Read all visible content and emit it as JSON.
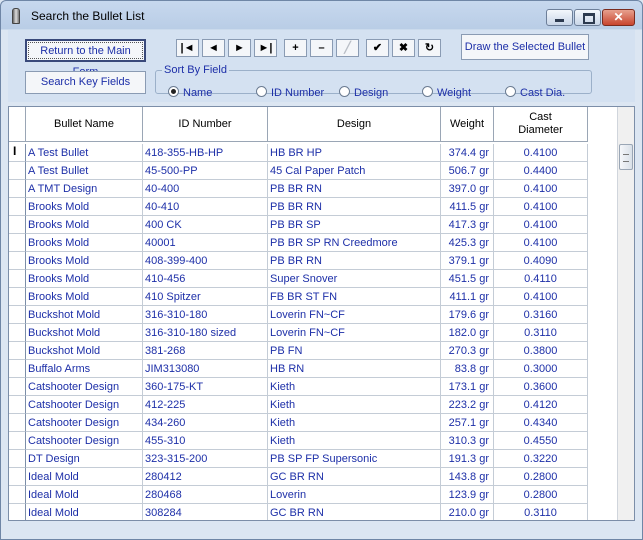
{
  "window": {
    "title": "Search the Bullet List"
  },
  "toolbar": {
    "main_form_label": "Return to the Main Form",
    "search_key_label": "Search Key Fields",
    "draw_label": "Draw the Selected Bullet",
    "sort_legend": "Sort By Field",
    "sort_options": [
      "Name",
      "ID Number",
      "Design",
      "Weight",
      "Cast Dia."
    ],
    "sort_selected": "Name"
  },
  "nav_buttons": [
    {
      "icon": "first-record-icon",
      "glyph": "|◄"
    },
    {
      "icon": "prev-record-icon",
      "glyph": "◄"
    },
    {
      "icon": "next-record-icon",
      "glyph": "►"
    },
    {
      "icon": "last-record-icon",
      "glyph": "►|"
    },
    {
      "icon": "add-record-icon",
      "glyph": "+"
    },
    {
      "icon": "delete-record-icon",
      "glyph": "–"
    },
    {
      "icon": "edit-record-icon",
      "glyph": "╱"
    },
    {
      "icon": "post-record-icon",
      "glyph": "✔"
    },
    {
      "icon": "cancel-record-icon",
      "glyph": "✖"
    },
    {
      "icon": "refresh-icon",
      "glyph": "↻"
    }
  ],
  "table": {
    "columns": [
      "Bullet Name",
      "ID Number",
      "Design",
      "Weight",
      "Cast\nDiameter"
    ],
    "rows": [
      [
        "A Test Bullet",
        "418-355-HB-HP",
        "HB BR HP",
        "374.4 gr",
        "0.4100"
      ],
      [
        "A Test Bullet",
        "45-500-PP",
        "45 Cal Paper Patch",
        "506.7 gr",
        "0.4400"
      ],
      [
        "A TMT Design",
        "40-400",
        "PB BR RN",
        "397.0 gr",
        "0.4100"
      ],
      [
        "Brooks Mold",
        "40-410",
        "PB BR RN",
        "411.5 gr",
        "0.4100"
      ],
      [
        "Brooks Mold",
        "400 CK",
        "PB BR SP",
        "417.3 gr",
        "0.4100"
      ],
      [
        "Brooks Mold",
        "40001",
        "PB BR SP RN Creedmore",
        "425.3 gr",
        "0.4100"
      ],
      [
        "Brooks Mold",
        "408-399-400",
        "PB BR RN",
        "379.1 gr",
        "0.4090"
      ],
      [
        "Brooks Mold",
        "410-456",
        "Super Snover",
        "451.5 gr",
        "0.4110"
      ],
      [
        "Brooks Mold",
        "410 Spitzer",
        "FB BR ST FN",
        "411.1 gr",
        "0.4100"
      ],
      [
        "Buckshot Mold",
        "316-310-180",
        "Loverin FN~CF",
        "179.6 gr",
        "0.3160"
      ],
      [
        "Buckshot Mold",
        "316-310-180 sized",
        "Loverin FN~CF",
        "182.0 gr",
        "0.3110"
      ],
      [
        "Buckshot Mold",
        "381-268",
        "PB FN",
        "270.3 gr",
        "0.3800"
      ],
      [
        "Buffalo Arms",
        "JIM313080",
        "HB RN",
        "83.8 gr",
        "0.3000"
      ],
      [
        "Catshooter Design",
        "360-175-KT",
        "Kieth",
        "173.1 gr",
        "0.3600"
      ],
      [
        "Catshooter Design",
        "412-225",
        "Kieth",
        "223.2 gr",
        "0.4120"
      ],
      [
        "Catshooter Design",
        "434-260",
        "Kieth",
        "257.1 gr",
        "0.4340"
      ],
      [
        "Catshooter Design",
        "455-310",
        "Kieth",
        "310.3 gr",
        "0.4550"
      ],
      [
        "DT Design",
        "323-315-200",
        "PB SP FP  Supersonic",
        "191.3 gr",
        "0.3220"
      ],
      [
        "Ideal Mold",
        "280412",
        "GC BR RN",
        "143.8 gr",
        "0.2800"
      ],
      [
        "Ideal Mold",
        "280468",
        "Loverin",
        "123.9 gr",
        "0.2800"
      ],
      [
        "Ideal Mold",
        "308284",
        "GC BR RN",
        "210.0 gr",
        "0.3110"
      ]
    ]
  },
  "row_cursor_glyph": "I"
}
